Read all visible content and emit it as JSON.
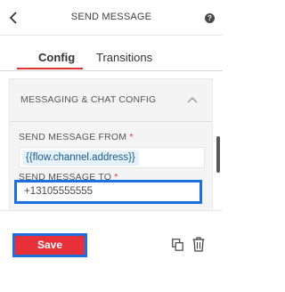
{
  "header": {
    "title": "SEND MESSAGE",
    "help_glyph": "?"
  },
  "tabs": [
    {
      "label": "Config",
      "active": true
    },
    {
      "label": "Transitions",
      "active": false
    }
  ],
  "section": {
    "title": "MESSAGING & CHAT CONFIG",
    "expanded": true
  },
  "fields": {
    "from": {
      "label": "SEND MESSAGE FROM",
      "required_mark": "*",
      "value": "{{flow.channel.address}}"
    },
    "to": {
      "label": "SEND MESSAGE TO",
      "required_mark": "*",
      "value": "+13105555555"
    }
  },
  "footer": {
    "save_label": "Save"
  },
  "colors": {
    "accent": "#e33131",
    "save_button": "#e8303b",
    "focus_outline": "#1c6fdc",
    "variable_pill": "#e6f2fb"
  },
  "icons": [
    "back-chevron-icon",
    "help-icon",
    "chevron-up-icon",
    "copy-icon",
    "trash-icon"
  ]
}
